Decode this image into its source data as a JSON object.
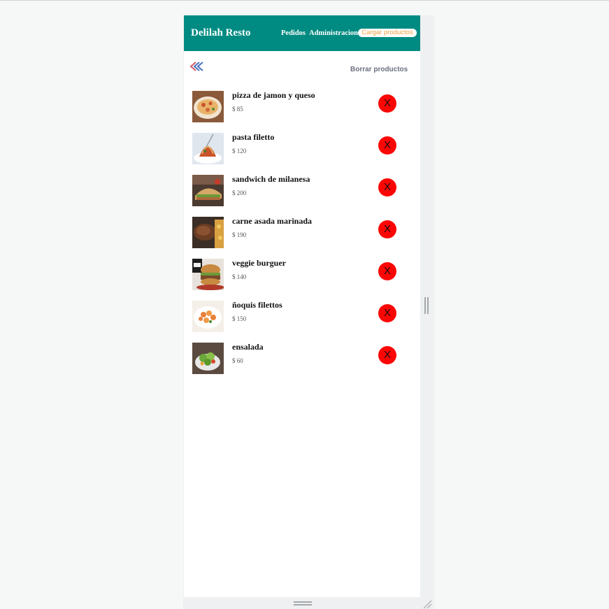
{
  "navbar": {
    "brand": "Delilah Resto",
    "links": [
      "Pedidos",
      "Administracion"
    ],
    "cta": "Cargar productos"
  },
  "toolbar": {
    "back_icon": "double-chevron-left-icon",
    "delete_all": "Borrar productos"
  },
  "products": [
    {
      "name": "pizza de jamon y queso",
      "price": "$ 85",
      "delete": "X",
      "thumb": "pizza"
    },
    {
      "name": "pasta filetto",
      "price": "$ 120",
      "delete": "X",
      "thumb": "pasta"
    },
    {
      "name": "sandwich de milanesa",
      "price": "$ 200",
      "delete": "X",
      "thumb": "sandwich"
    },
    {
      "name": "carne asada marinada",
      "price": "$ 190",
      "delete": "X",
      "thumb": "meat"
    },
    {
      "name": "veggie burguer",
      "price": "$ 140",
      "delete": "X",
      "thumb": "burger"
    },
    {
      "name": "ñoquis filettos",
      "price": "$ 150",
      "delete": "X",
      "thumb": "gnocchi"
    },
    {
      "name": "ensalada",
      "price": "$ 60",
      "delete": "X",
      "thumb": "salad"
    }
  ],
  "colors": {
    "navbar": "#008b82",
    "cta_text": "#f0a040",
    "delete_button": "#fc0505",
    "background": "#f6f8f7"
  }
}
